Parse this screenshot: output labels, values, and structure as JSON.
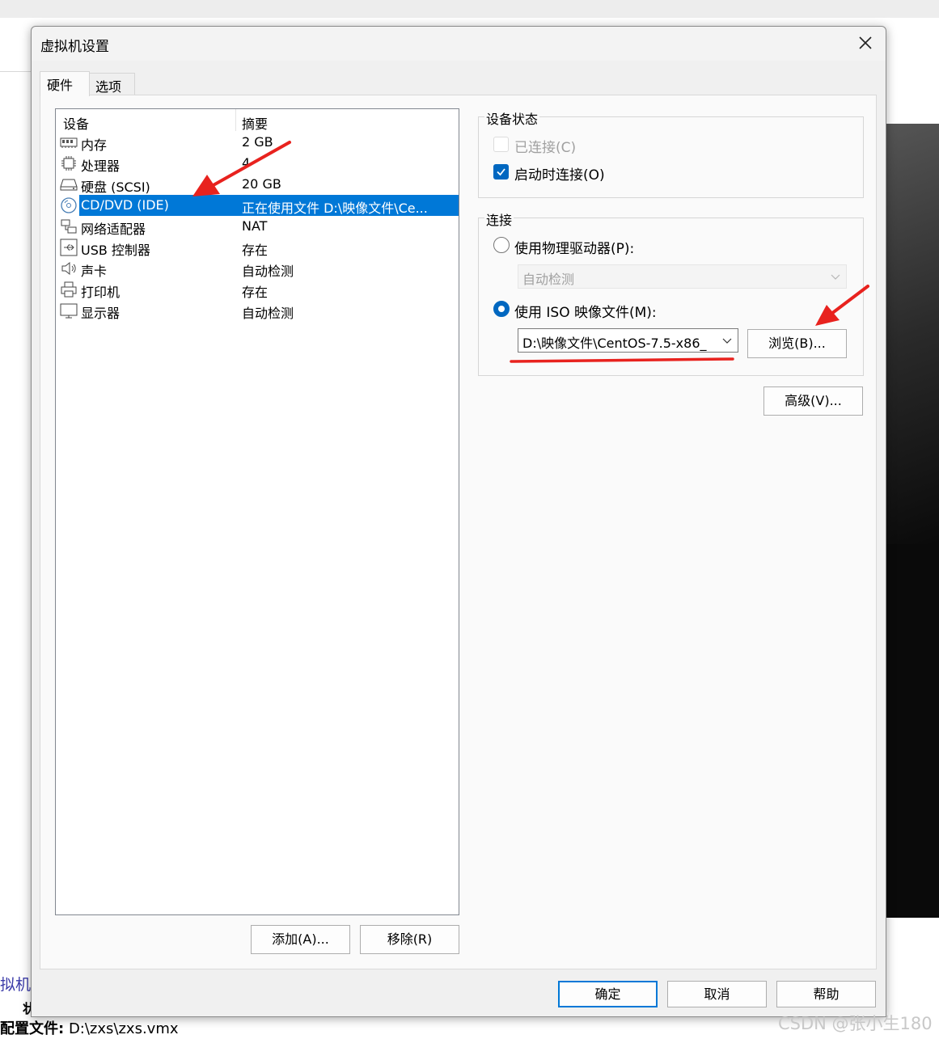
{
  "background": {
    "link_text": "拟机",
    "glyph_text": "状",
    "config_label": "配置文件:",
    "config_value": "D:\\zxs\\zxs.vmx",
    "watermark": "CSDN @张小生180"
  },
  "dialog": {
    "title": "虚拟机设置",
    "tabs": [
      {
        "label": "硬件",
        "selected": true
      },
      {
        "label": "选项",
        "selected": false
      }
    ],
    "device_list": {
      "headers": {
        "device": "设备",
        "summary": "摘要"
      },
      "rows": [
        {
          "icon": "memory-icon",
          "name": "内存",
          "summary": "2 GB"
        },
        {
          "icon": "processor-icon",
          "name": "处理器",
          "summary": "4"
        },
        {
          "icon": "hard-disk-icon",
          "name": "硬盘 (SCSI)",
          "summary": "20 GB"
        },
        {
          "icon": "cd-dvd-icon",
          "name": "CD/DVD (IDE)",
          "summary": "正在使用文件 D:\\映像文件\\Ce...",
          "selected": true
        },
        {
          "icon": "network-adapter-icon",
          "name": "网络适配器",
          "summary": "NAT"
        },
        {
          "icon": "usb-icon",
          "name": "USB 控制器",
          "summary": "存在"
        },
        {
          "icon": "sound-icon",
          "name": "声卡",
          "summary": "自动检测"
        },
        {
          "icon": "printer-icon",
          "name": "打印机",
          "summary": "存在"
        },
        {
          "icon": "display-icon",
          "name": "显示器",
          "summary": "自动检测"
        }
      ]
    },
    "add_button": "添加(A)...",
    "remove_button": "移除(R)",
    "device_status": {
      "title": "设备状态",
      "connected": {
        "label": "已连接(C)",
        "checked": false,
        "disabled": true
      },
      "connect_at_power_on": {
        "label": "启动时连接(O)",
        "checked": true
      }
    },
    "connection": {
      "title": "连接",
      "physical_drive": {
        "label": "使用物理驱动器(P):",
        "selected": false
      },
      "physical_drive_value": "自动检测",
      "iso_image": {
        "label": "使用 ISO 映像文件(M):",
        "selected": true
      },
      "iso_path": "D:\\映像文件\\CentOS-7.5-x86_",
      "browse_button": "浏览(B)..."
    },
    "advanced_button": "高级(V)...",
    "ok_button": "确定",
    "cancel_button": "取消",
    "help_button": "帮助"
  },
  "colors": {
    "selection": "#0078d7",
    "checkbox_accent": "#0067c0",
    "annotation_red": "#e8221e"
  }
}
